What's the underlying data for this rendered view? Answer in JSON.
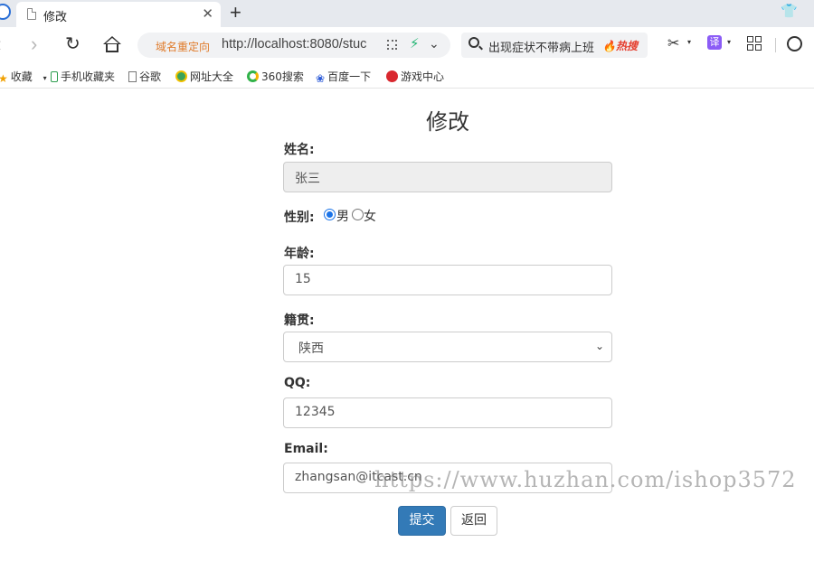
{
  "browser": {
    "tab_title": "修改",
    "tab_close": "✕",
    "new_tab": "+",
    "address_redirect": "域名重定向",
    "address_url": "http://localhost:8080/stuc",
    "search_query": "出现症状不带病上班",
    "search_badge": "🔥热搜",
    "translate_label": "译"
  },
  "bookmarks": [
    {
      "label": "收藏"
    },
    {
      "label": "手机收藏夹"
    },
    {
      "label": "谷歌"
    },
    {
      "label": "网址大全"
    },
    {
      "label": "360搜索"
    },
    {
      "label": "百度一下"
    },
    {
      "label": "游戏中心"
    }
  ],
  "form": {
    "title": "修改",
    "name_label": "姓名:",
    "name_value": "张三",
    "gender_label": "性别:",
    "gender_male": "男",
    "gender_female": "女",
    "gender_selected": "男",
    "age_label": "年龄:",
    "age_value": "15",
    "origin_label": "籍贯:",
    "origin_value": "陕西",
    "qq_label": "QQ:",
    "qq_value": "12345",
    "email_label": "Email:",
    "email_value": "zhangsan@itcast.cn",
    "submit_label": "提交",
    "back_label": "返回"
  },
  "watermark": "https://www.huzhan.com/ishop3572"
}
